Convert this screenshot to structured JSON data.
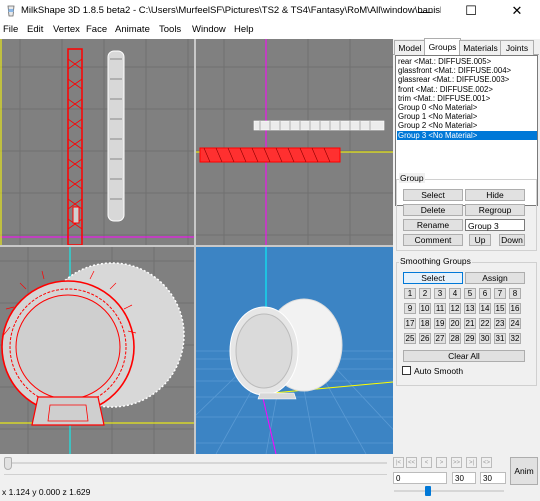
{
  "window": {
    "title": "MilkShape 3D 1.8.5 beta2 - C:\\Users\\MurfeelSF\\Pictures\\TS2 & TS4\\Fantasy\\RoM\\All\\window\\banishe...",
    "minimize_glyph": "—",
    "maximize_glyph": "☐",
    "close_glyph": "✕"
  },
  "menu": [
    "File",
    "Edit",
    "Vertex",
    "Face",
    "Animate",
    "Tools",
    "Window",
    "Help"
  ],
  "tabs": [
    {
      "label": "Model",
      "active": false
    },
    {
      "label": "Groups",
      "active": true
    },
    {
      "label": "Materials",
      "active": false
    },
    {
      "label": "Joints",
      "active": false
    }
  ],
  "groups": [
    {
      "label": "rear <Mat.: DIFFUSE.005>",
      "selected": false
    },
    {
      "label": "glassfront <Mat.: DIFFUSE.004>",
      "selected": false
    },
    {
      "label": "glassrear <Mat.: DIFFUSE.003>",
      "selected": false
    },
    {
      "label": "front <Mat.: DIFFUSE.002>",
      "selected": false
    },
    {
      "label": "trim <Mat.: DIFFUSE.001>",
      "selected": false
    },
    {
      "label": "Group 0 <No Material>",
      "selected": false
    },
    {
      "label": "Group 1 <No Material>",
      "selected": false
    },
    {
      "label": "Group 2 <No Material>",
      "selected": false
    },
    {
      "label": "Group 3 <No Material>",
      "selected": true
    }
  ],
  "group_box": {
    "legend": "Group",
    "select": "Select",
    "hide": "Hide",
    "delete": "Delete",
    "regroup": "Regroup",
    "rename": "Rename",
    "name_value": "Group 3",
    "comment": "Comment",
    "up": "Up",
    "down": "Down"
  },
  "smoothing": {
    "legend": "Smoothing Groups",
    "select": "Select",
    "assign": "Assign",
    "numbers": [
      "1",
      "2",
      "3",
      "4",
      "5",
      "6",
      "7",
      "8",
      "9",
      "10",
      "11",
      "12",
      "13",
      "14",
      "15",
      "16",
      "17",
      "18",
      "19",
      "20",
      "21",
      "22",
      "23",
      "24",
      "25",
      "26",
      "27",
      "28",
      "29",
      "30",
      "31",
      "32"
    ],
    "clear_all": "Clear All",
    "auto_smooth": "Auto Smooth",
    "auto_smooth_checked": false
  },
  "animation": {
    "nav_glyphs": [
      "|<",
      "<<",
      "<",
      ">",
      ">>",
      ">|",
      "<>"
    ],
    "current_frame": "0",
    "start_frame": "30",
    "total_frames": "30",
    "anim_label": "Anim"
  },
  "status": {
    "coords": "x 1.124 y 0.000 z 1.629"
  },
  "colors": {
    "viewport_bg": "#808080",
    "viewport3d_bg": "#3c84c4",
    "selection_red": "#ff0000",
    "list_selection": "#0078d7"
  }
}
